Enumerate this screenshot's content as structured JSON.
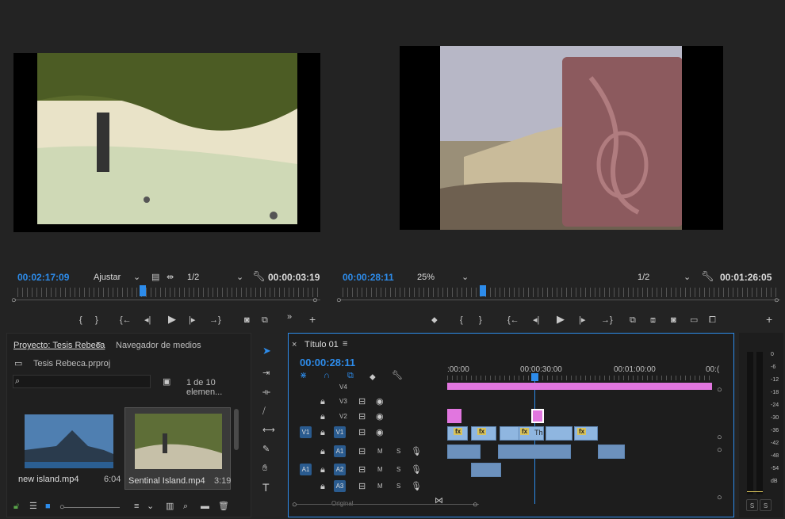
{
  "source_monitor": {
    "timecode": "00:02:17:09",
    "fit": "Ajustar",
    "resolution": "1/2",
    "duration": "00:00:03:19"
  },
  "program_monitor": {
    "timecode": "00:00:28:11",
    "zoom": "25%",
    "resolution": "1/2",
    "duration": "00:01:26:05"
  },
  "project": {
    "tab_project": "Proyecto: Tesis Rebeca",
    "tab_media": "Navegador de medios",
    "file": "Tesis Rebeca.prproj",
    "count": "1 de 10 elemen...",
    "items": [
      {
        "name": "new island.mp4",
        "dur": "6:04"
      },
      {
        "name": "Sentinal Island.mp4",
        "dur": "3:19"
      }
    ]
  },
  "timeline": {
    "title": "Título 01",
    "timecode": "00:00:28:11",
    "ruler": [
      ":00:00",
      "00:00:30:00",
      "00:01:00:00",
      "00:("
    ],
    "tracks_video": [
      "V4",
      "V3",
      "V2",
      "V1"
    ],
    "tracks_audio": [
      "A1",
      "A2",
      "A3"
    ],
    "src_v1": "V1",
    "src_a1": "A1",
    "clip_label": "Th",
    "master": "Original",
    "mute": "M",
    "solo": "S"
  },
  "meter": {
    "scale": [
      "0",
      "-6",
      "-12",
      "-18",
      "-24",
      "-30",
      "-36",
      "-42",
      "-48",
      "-54",
      "dB"
    ],
    "solo": [
      "S",
      "S"
    ]
  }
}
